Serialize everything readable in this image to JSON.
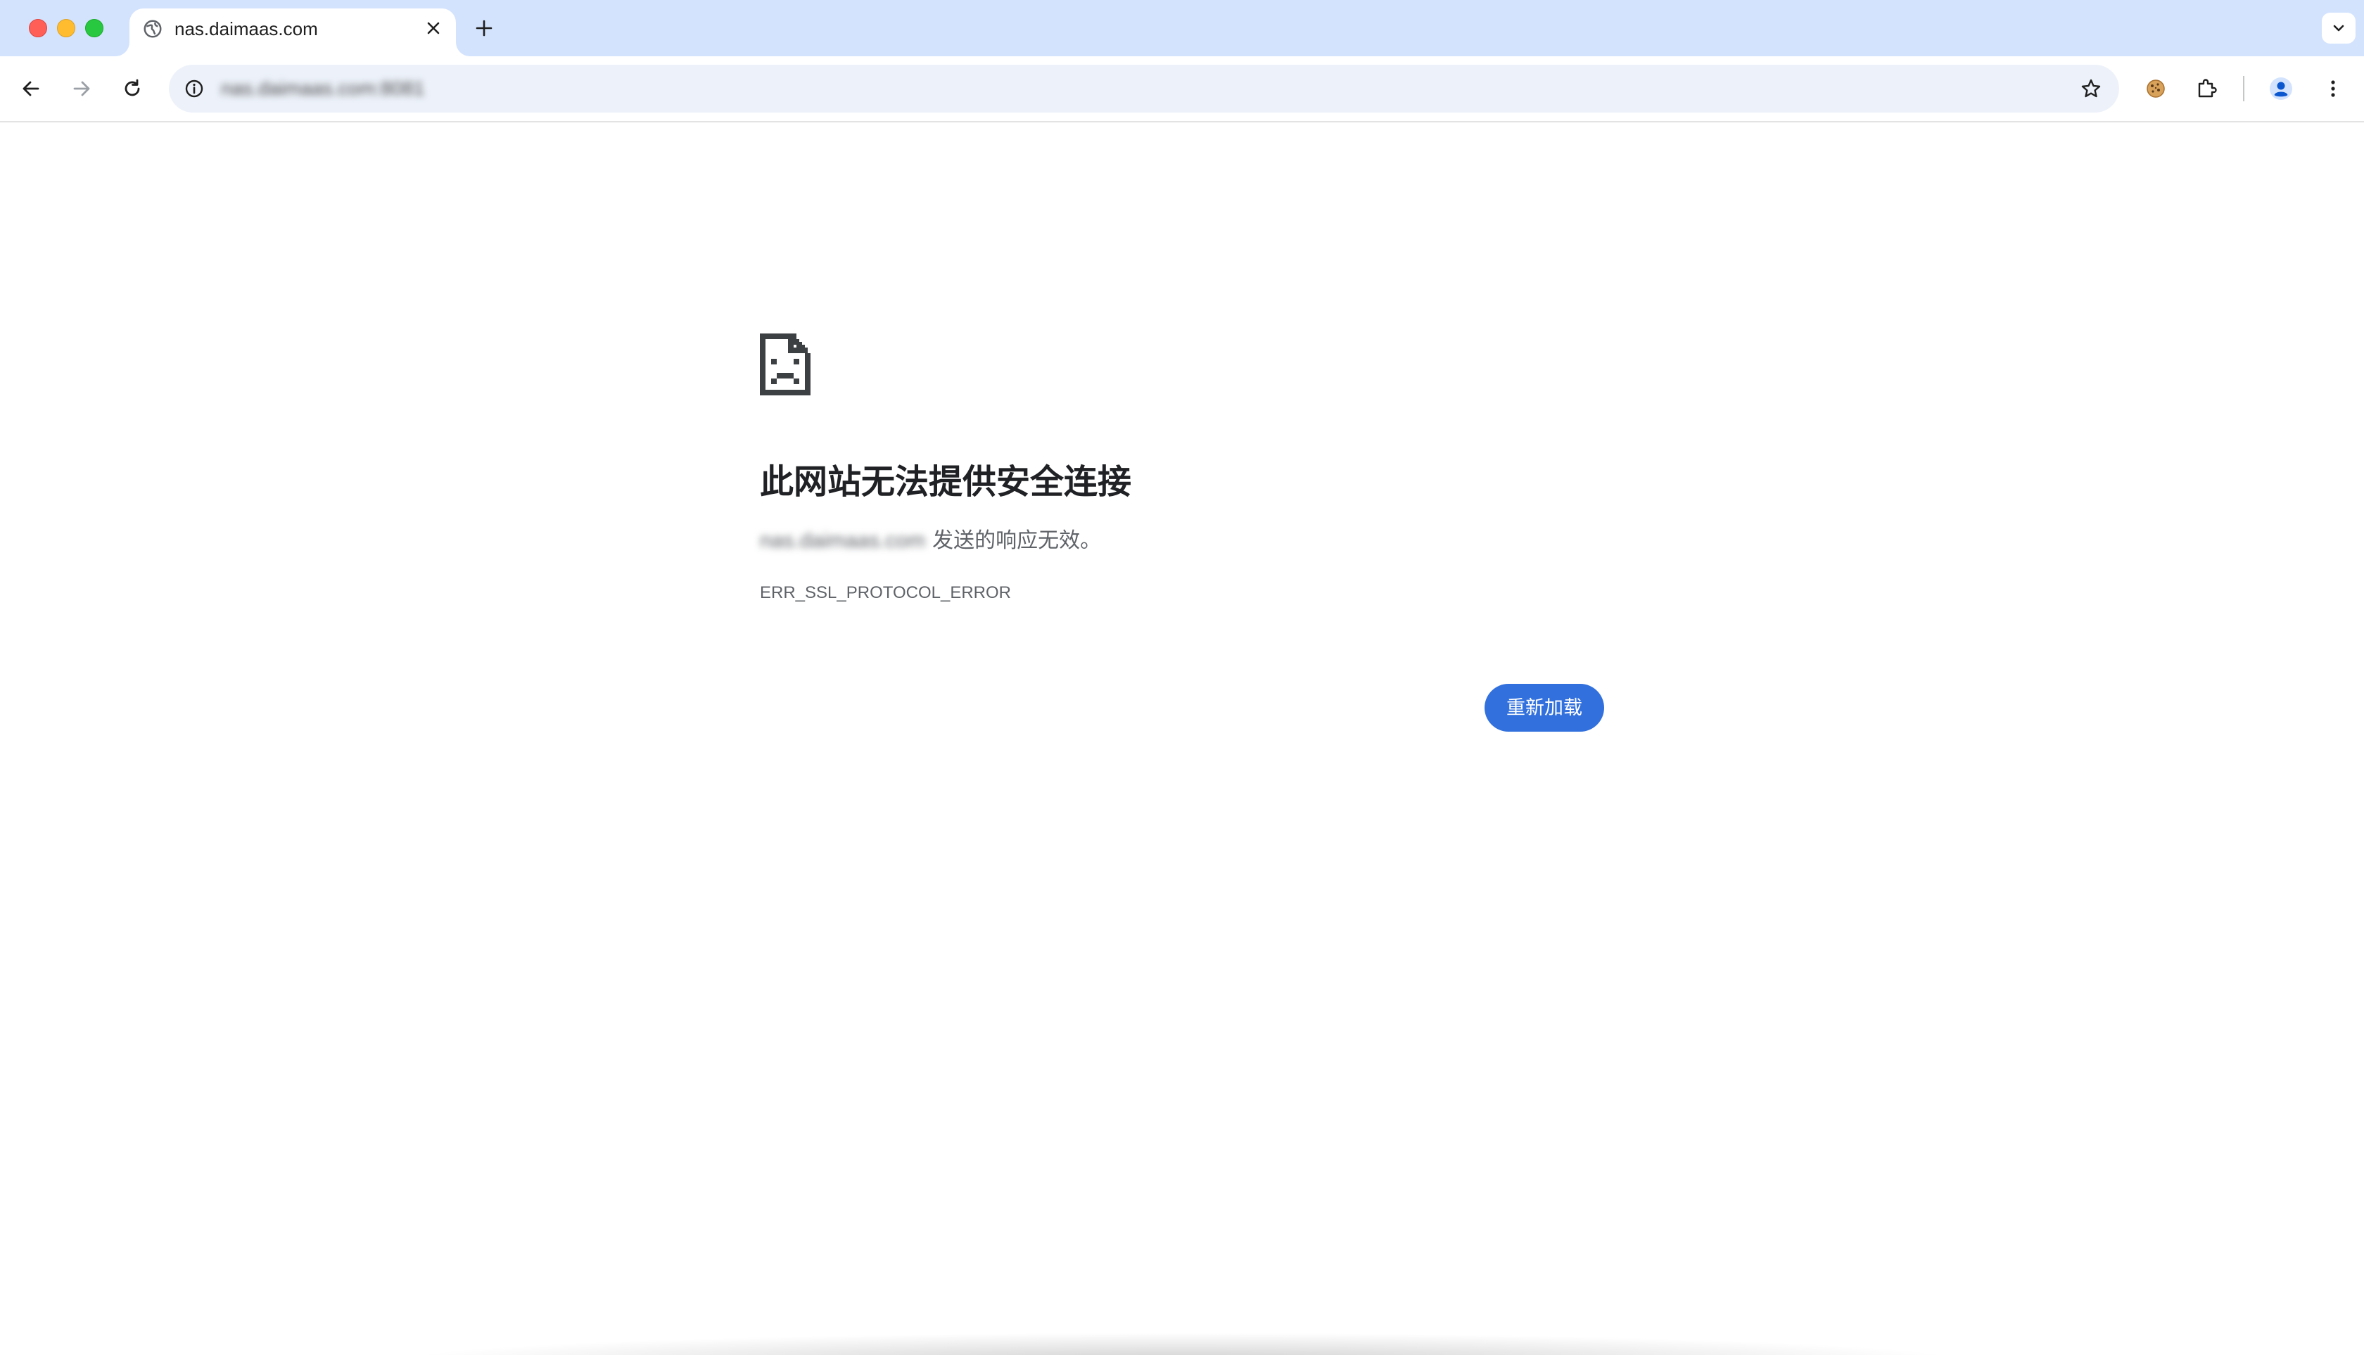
{
  "tab": {
    "title": "nas.daimaas.com",
    "favicon": "globe-icon"
  },
  "toolbar": {
    "url": "nas.daimaas.com:8081"
  },
  "error": {
    "icon": "sad-page-icon",
    "heading": "此网站无法提供安全连接",
    "host": "nas.daimaas.com",
    "description": "发送的响应无效。",
    "code": "ERR_SSL_PROTOCOL_ERROR",
    "reload_label": "重新加载"
  },
  "colors": {
    "tabstrip": "#d3e3fd",
    "omnibox": "#edf2fa",
    "reload_button": "#3170dd"
  }
}
